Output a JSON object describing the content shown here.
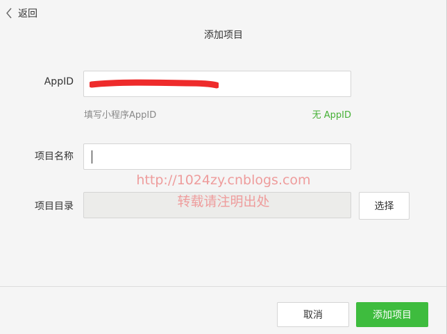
{
  "header": {
    "back_label": "返回",
    "title": "添加项目"
  },
  "form": {
    "appid": {
      "label": "AppID",
      "value": "",
      "value_redacted": true,
      "redaction_color": "#ee2b2b",
      "hint": "填写小程序AppID",
      "no_appid_link": "无 AppID"
    },
    "project_name": {
      "label": "项目名称",
      "value": ""
    },
    "project_dir": {
      "label": "项目目录",
      "value": "",
      "choose_label": "选择"
    }
  },
  "footer": {
    "cancel_label": "取消",
    "add_label": "添加项目"
  },
  "watermark": {
    "line1": "http://1024zy.cnblogs.com",
    "line2": "转载请注明出处"
  },
  "colors": {
    "primary": "#3ebc3e",
    "link": "#45b035",
    "watermark": "#ee9c9c"
  }
}
